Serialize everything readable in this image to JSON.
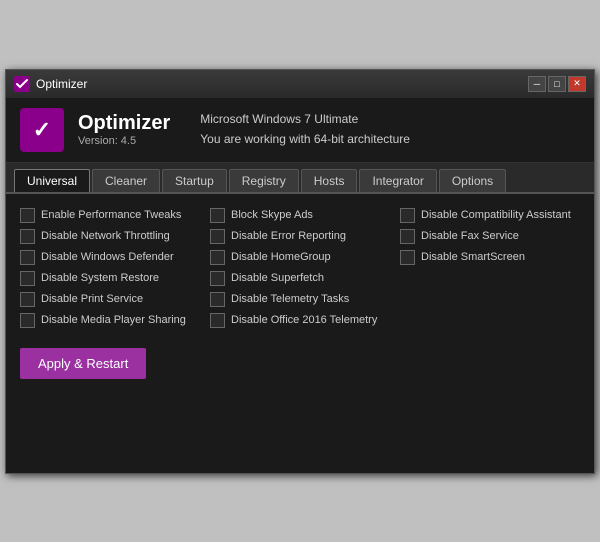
{
  "window": {
    "title": "Optimizer",
    "controls": {
      "minimize": "─",
      "maximize": "□",
      "close": "✕"
    }
  },
  "header": {
    "app_name": "Optimizer",
    "version": "Version: 4.5",
    "os_info": "Microsoft Windows 7 Ultimate",
    "arch_info": "You are working with 64-bit architecture"
  },
  "tabs": [
    {
      "id": "universal",
      "label": "Universal",
      "active": true
    },
    {
      "id": "cleaner",
      "label": "Cleaner",
      "active": false
    },
    {
      "id": "startup",
      "label": "Startup",
      "active": false
    },
    {
      "id": "registry",
      "label": "Registry",
      "active": false
    },
    {
      "id": "hosts",
      "label": "Hosts",
      "active": false
    },
    {
      "id": "integrator",
      "label": "Integrator",
      "active": false
    },
    {
      "id": "options",
      "label": "Options",
      "active": false
    }
  ],
  "options": {
    "col1": [
      {
        "id": "perf",
        "label": "Enable Performance Tweaks"
      },
      {
        "id": "throttle",
        "label": "Disable Network Throttling"
      },
      {
        "id": "defender",
        "label": "Disable Windows Defender"
      },
      {
        "id": "restore",
        "label": "Disable System Restore"
      },
      {
        "id": "print",
        "label": "Disable Print Service"
      },
      {
        "id": "mediashare",
        "label": "Disable Media Player Sharing"
      }
    ],
    "col2": [
      {
        "id": "skype",
        "label": "Block Skype Ads"
      },
      {
        "id": "error",
        "label": "Disable Error Reporting"
      },
      {
        "id": "homegroup",
        "label": "Disable HomeGroup"
      },
      {
        "id": "superfetch",
        "label": "Disable Superfetch"
      },
      {
        "id": "telemetry",
        "label": "Disable Telemetry Tasks"
      },
      {
        "id": "office",
        "label": "Disable Office 2016 Telemetry"
      }
    ],
    "col3": [
      {
        "id": "compat",
        "label": "Disable Compatibility Assistant"
      },
      {
        "id": "fax",
        "label": "Disable Fax Service"
      },
      {
        "id": "smartscreen",
        "label": "Disable SmartScreen"
      }
    ]
  },
  "buttons": {
    "apply": "Apply & Restart"
  }
}
